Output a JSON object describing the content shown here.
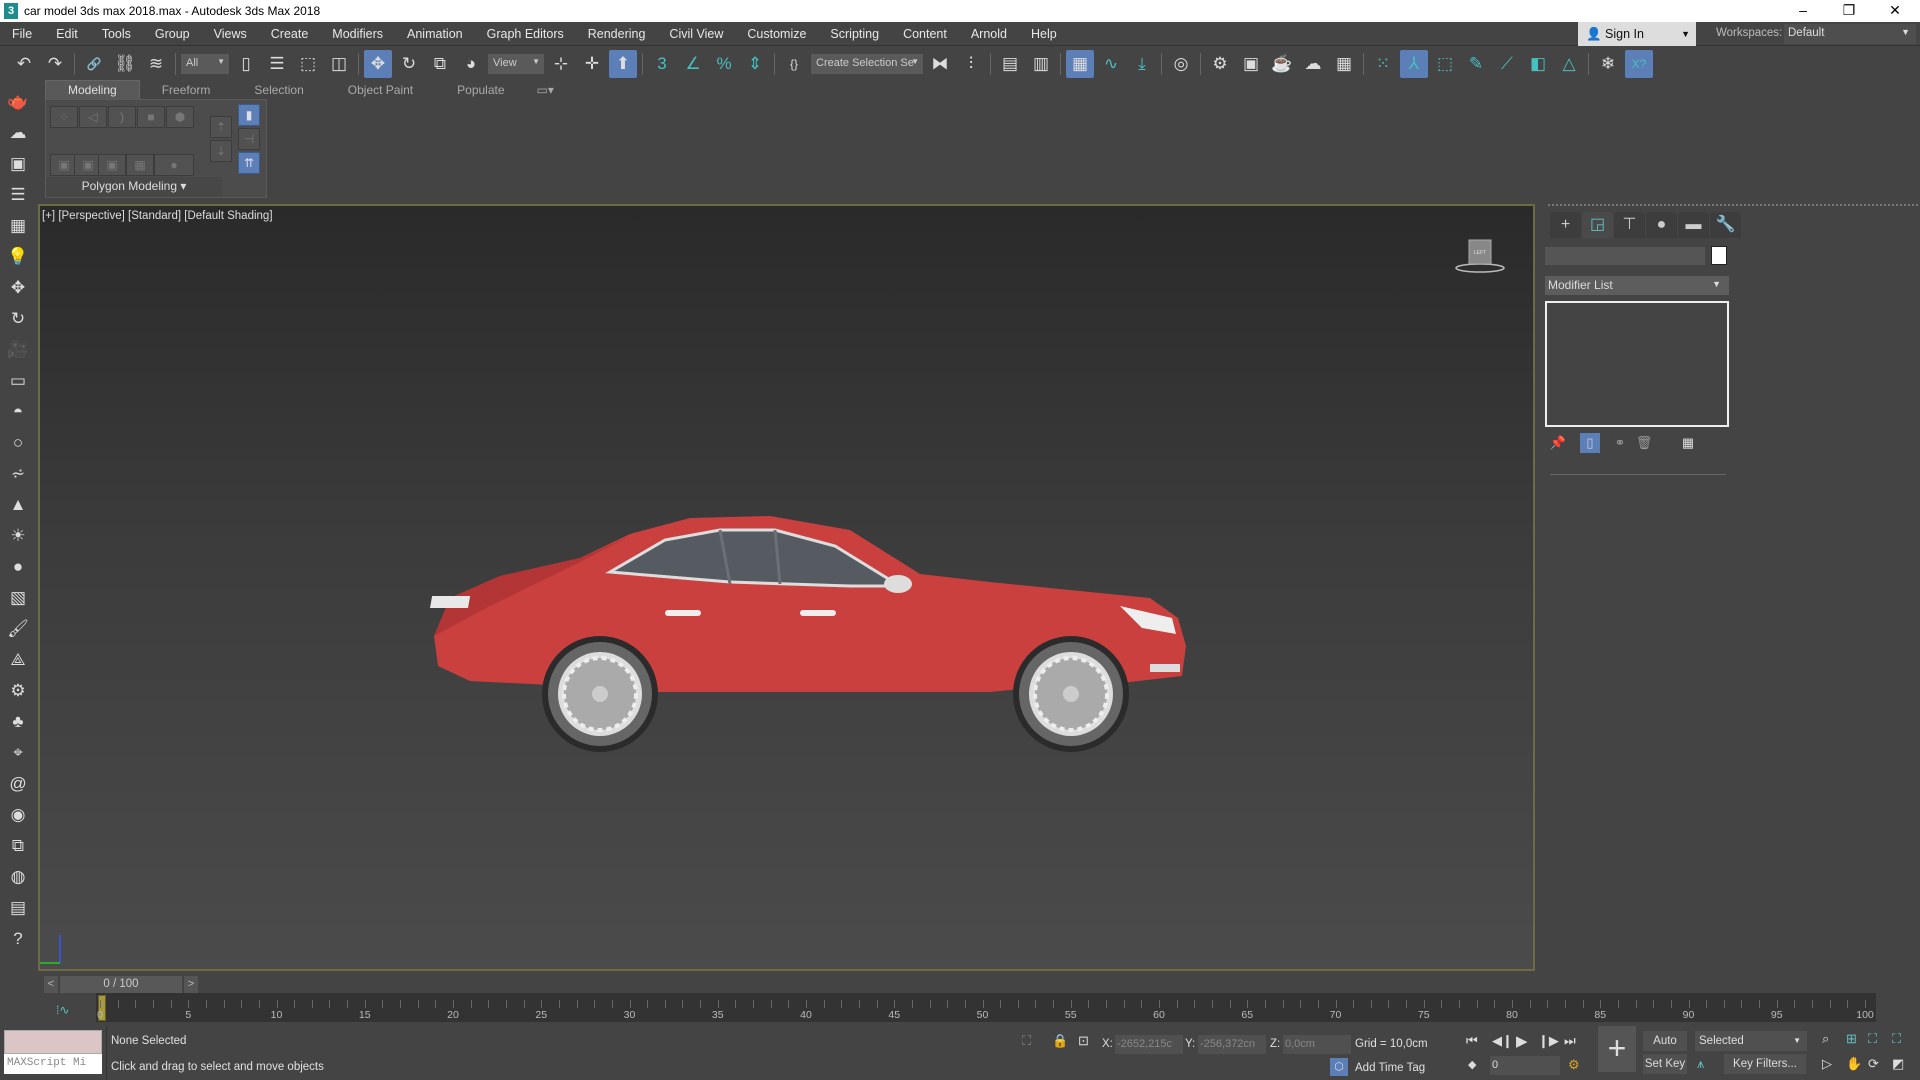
{
  "app": {
    "title": "car model 3ds max 2018.max - Autodesk 3ds Max 2018",
    "logo": "3"
  },
  "window_controls": [
    "minimize-icon",
    "restore-icon",
    "close-icon"
  ],
  "menu": [
    "File",
    "Edit",
    "Tools",
    "Group",
    "Views",
    "Create",
    "Modifiers",
    "Animation",
    "Graph Editors",
    "Rendering",
    "Civil View",
    "Customize",
    "Scripting",
    "Content",
    "Arnold",
    "Help"
  ],
  "account": {
    "sign_in": "Sign In",
    "workspaces_label": "Workspaces:",
    "workspace": "Default"
  },
  "toolbar": {
    "selection_filter": "All",
    "ref_coord": "View",
    "named_selection": "Create Selection Se",
    "icons": [
      "undo-icon",
      "redo-icon",
      "|",
      "link-icon",
      "unlink-icon",
      "bind-space-warp-icon",
      "|",
      "FILTER",
      "select-object-icon",
      "select-by-name-icon",
      "rectangular-selection-icon",
      "window-crossing-icon",
      "|",
      "*select-and-move-icon",
      "select-and-rotate-icon",
      "select-and-scale-icon",
      "select-and-place-icon",
      "REF",
      "use-pivot-icon",
      "select-manipulate-icon",
      "*keyboard-shortcut-override-icon",
      "|",
      "snaps-toggle-icon",
      "angle-snap-icon",
      "percent-snap-icon",
      "spinner-snap-icon",
      "|",
      "edit-named-selection-icon",
      "NAMED",
      "mirror-icon",
      "align-icon",
      "|",
      "scene-explorer-icon",
      "layer-explorer-icon",
      "|",
      "*toggle-ribbon-icon",
      "curve-editor-icon",
      "dope-sheet-icon",
      "|",
      "material-editor-icon",
      "|",
      "render-setup-icon",
      "rendered-frame-window-icon",
      "render-production-icon",
      "render-cloud-icon",
      "render-view-icon",
      "|",
      "grid-snap-icon",
      "*arnold-icon",
      "arnold-box-icon",
      "arnold-edit-icon",
      "arnold-line-icon",
      "arnold-toggle-icon",
      "arnold-cone-icon",
      "|",
      "freeze-icon",
      "*arnold-xp-icon"
    ]
  },
  "ribbon": {
    "tabs": [
      "Modeling",
      "Freeform",
      "Selection",
      "Object Paint",
      "Populate"
    ],
    "active_tab": "Modeling",
    "panel_label": "Polygon Modeling"
  },
  "left_tools": [
    "teapot-icon",
    "cloud-icon",
    "render-icon",
    "list-icon",
    "table-icon",
    "light-icon",
    "move-icon",
    "rotate-icon",
    "camera-icon",
    "display-icon",
    "sphere-icon",
    "circle-icon",
    "hair-icon",
    "cone-icon",
    "sun-icon",
    "globe-icon",
    "grid-icon",
    "paint-icon",
    "shape-icon",
    "gear-icon",
    "plant-icon",
    "helper-icon",
    "spiral-icon",
    "material-icon",
    "dataset-icon",
    "world-icon",
    "manual-icon",
    "help-icon"
  ],
  "viewport": {
    "labels": [
      "[+]",
      "[Perspective]",
      "[Standard]",
      "[Default Shading]"
    ],
    "car_color": "#c9403f",
    "viewcube_label": "LEFT"
  },
  "command_panel": {
    "tabs": [
      "create-icon",
      "modify-icon",
      "hierarchy-icon",
      "motion-icon",
      "display-icon",
      "utilities-icon"
    ],
    "active_tab": 1,
    "modifier_list": "Modifier List"
  },
  "timeline": {
    "frame": "0 / 100",
    "prev": "<",
    "next": ">",
    "ticks": [
      0,
      5,
      10,
      15,
      20,
      25,
      30,
      35,
      40,
      45,
      50,
      55,
      60,
      65,
      70,
      75,
      80,
      85,
      90,
      95,
      100
    ]
  },
  "status": {
    "maxscript": "MAXScript Mi",
    "selection": "None Selected",
    "prompt": "Click and drag to select and move objects",
    "x_label": "X:",
    "x": "-2652,215c",
    "y_label": "Y:",
    "y": "-256,372cn",
    "z_label": "Z:",
    "z": "0,0cm",
    "grid": "Grid = 10,0cm",
    "add_time_tag": "Add Time Tag",
    "auto_key": "Auto Key",
    "set_key": "Set Key",
    "key_mode": "Selected",
    "key_filters": "Key Filters...",
    "current_frame": "0"
  }
}
